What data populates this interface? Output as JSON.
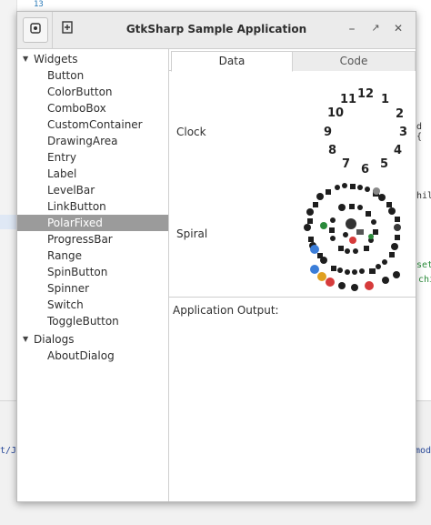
{
  "background": {
    "line_number": "13",
    "code_fragments": [
      "d {",
      "hile",
      "set",
      "chi",
      "t/J",
      "mod"
    ]
  },
  "window": {
    "title": "GtkSharp Sample Application",
    "controls": {
      "minimize": "–",
      "restore": "↗",
      "close": "✕"
    }
  },
  "tree": {
    "groups": [
      {
        "label": "Widgets",
        "items": [
          "Button",
          "ColorButton",
          "ComboBox",
          "CustomContainer",
          "DrawingArea",
          "Entry",
          "Label",
          "LevelBar",
          "LinkButton",
          "PolarFixed",
          "ProgressBar",
          "Range",
          "SpinButton",
          "Spinner",
          "Switch",
          "ToggleButton"
        ]
      },
      {
        "label": "Dialogs",
        "items": [
          "AboutDialog"
        ]
      }
    ],
    "selected": "PolarFixed"
  },
  "tabs": [
    {
      "label": "Data",
      "active": true
    },
    {
      "label": "Code",
      "active": false
    }
  ],
  "data_rows": {
    "clock_label": "Clock",
    "spiral_label": "Spiral"
  },
  "clock_numbers": [
    "12",
    "1",
    "2",
    "3",
    "4",
    "5",
    "6",
    "7",
    "8",
    "9",
    "10",
    "11"
  ],
  "output": {
    "label": "Application Output:"
  },
  "colors": {
    "selection": "#9b9b9b",
    "titlebar": "#ebebeb"
  }
}
